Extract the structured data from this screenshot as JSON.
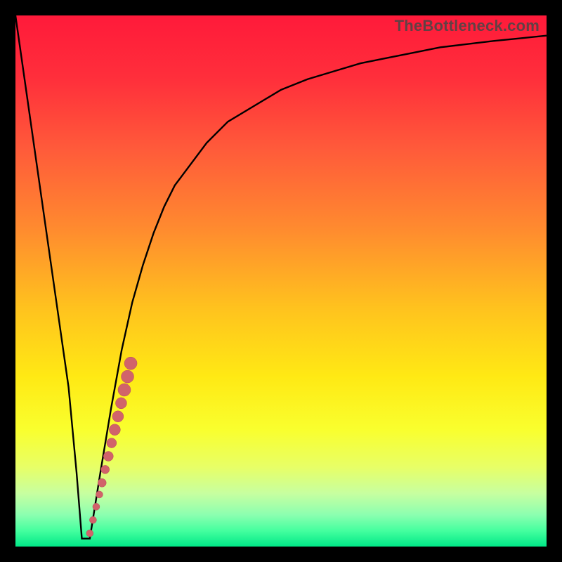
{
  "watermark": "TheBottleneck.com",
  "colors": {
    "gradient_stops": [
      {
        "offset": 0.0,
        "color": "#ff1a3a"
      },
      {
        "offset": 0.12,
        "color": "#ff2f3b"
      },
      {
        "offset": 0.25,
        "color": "#ff5a3a"
      },
      {
        "offset": 0.4,
        "color": "#ff8a2f"
      },
      {
        "offset": 0.55,
        "color": "#ffc21e"
      },
      {
        "offset": 0.68,
        "color": "#ffe914"
      },
      {
        "offset": 0.78,
        "color": "#f9ff2e"
      },
      {
        "offset": 0.85,
        "color": "#e8ff66"
      },
      {
        "offset": 0.9,
        "color": "#c7ffa0"
      },
      {
        "offset": 0.94,
        "color": "#8cffb0"
      },
      {
        "offset": 0.97,
        "color": "#45ff9f"
      },
      {
        "offset": 1.0,
        "color": "#00e887"
      }
    ],
    "curve": "#000000",
    "marker_fill": "#d1636a",
    "marker_stroke": "#b84e58"
  },
  "chart_data": {
    "type": "line",
    "title": "",
    "xlabel": "",
    "ylabel": "",
    "xlim": [
      0,
      100
    ],
    "ylim": [
      0,
      100
    ],
    "grid": false,
    "legend": false,
    "series": [
      {
        "name": "bottleneck-curve",
        "x": [
          0,
          2,
          4,
          6,
          8,
          10,
          11.5,
          12.5,
          14,
          16,
          18,
          20,
          22,
          24,
          26,
          28,
          30,
          33,
          36,
          40,
          45,
          50,
          55,
          60,
          65,
          70,
          75,
          80,
          85,
          90,
          95,
          100
        ],
        "y": [
          100,
          86,
          72,
          58,
          44,
          30,
          14,
          1.5,
          1.5,
          14,
          26,
          37,
          46,
          53,
          59,
          64,
          68,
          72,
          76,
          80,
          83,
          86,
          88,
          89.5,
          91,
          92,
          93,
          94,
          94.6,
          95.2,
          95.7,
          96.2
        ]
      }
    ],
    "markers": {
      "name": "highlighted-points",
      "points": [
        {
          "x": 14.0,
          "y": 2.5,
          "r": 5
        },
        {
          "x": 14.6,
          "y": 5.0,
          "r": 5
        },
        {
          "x": 15.2,
          "y": 7.5,
          "r": 5
        },
        {
          "x": 15.8,
          "y": 9.8,
          "r": 5
        },
        {
          "x": 16.3,
          "y": 12.0,
          "r": 6
        },
        {
          "x": 16.9,
          "y": 14.5,
          "r": 6
        },
        {
          "x": 17.5,
          "y": 17.0,
          "r": 7
        },
        {
          "x": 18.1,
          "y": 19.5,
          "r": 7
        },
        {
          "x": 18.7,
          "y": 22.0,
          "r": 8
        },
        {
          "x": 19.3,
          "y": 24.5,
          "r": 8
        },
        {
          "x": 19.9,
          "y": 27.0,
          "r": 8
        },
        {
          "x": 20.5,
          "y": 29.5,
          "r": 9
        },
        {
          "x": 21.1,
          "y": 32.0,
          "r": 9
        },
        {
          "x": 21.7,
          "y": 34.5,
          "r": 9
        }
      ]
    }
  }
}
